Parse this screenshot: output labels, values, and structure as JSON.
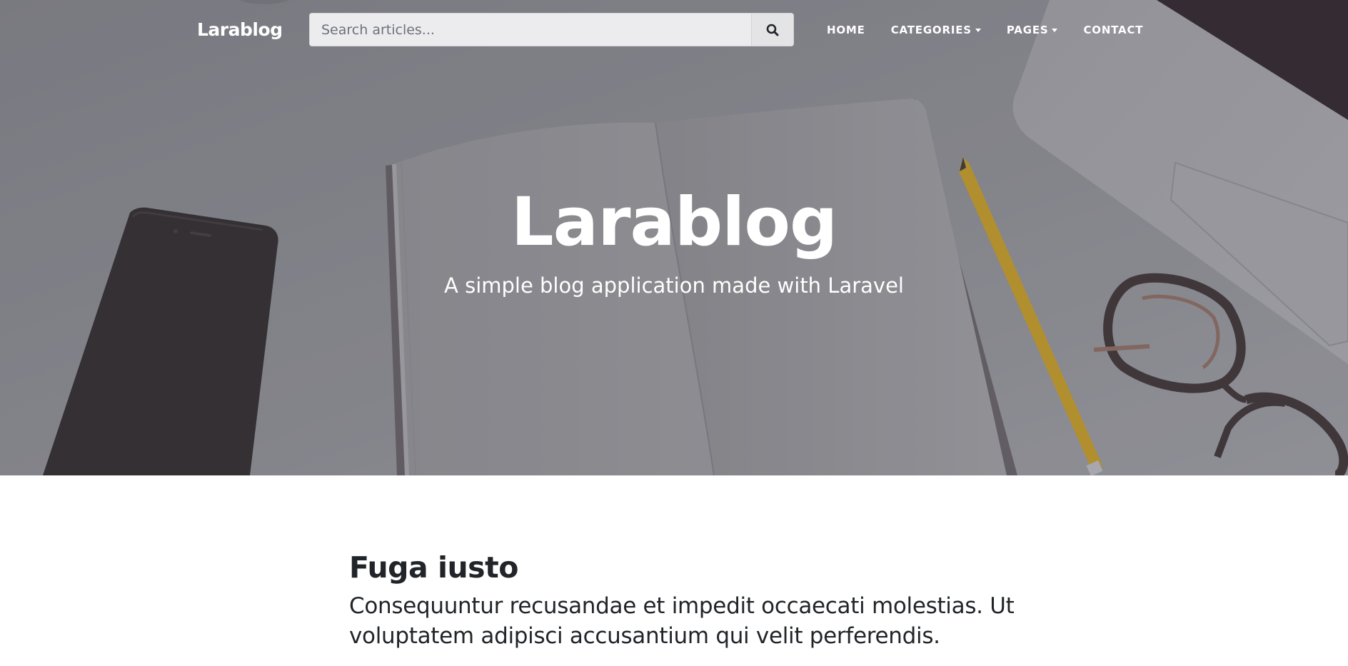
{
  "navbar": {
    "brand": "Larablog",
    "search": {
      "placeholder": "Search articles...",
      "value": ""
    },
    "links": [
      {
        "label": "HOME",
        "dropdown": false
      },
      {
        "label": "CATEGORIES",
        "dropdown": true
      },
      {
        "label": "PAGES",
        "dropdown": true
      },
      {
        "label": "CONTACT",
        "dropdown": false
      }
    ]
  },
  "hero": {
    "title": "Larablog",
    "subtitle": "A simple blog application made with Laravel"
  },
  "posts": [
    {
      "title": "Fuga iusto",
      "subtitle": "Consequuntur recusandae et impedit occaecati molestias. Ut voluptatem adipisci accusantium qui velit perferendis."
    }
  ],
  "colors": {
    "hero_tint": "#85858b",
    "text_dark": "#212529",
    "nav_text": "#ffffff",
    "search_bg": "#ececee"
  },
  "icons": {
    "search_button": "search-icon",
    "dropdown": "caret-down-icon"
  }
}
